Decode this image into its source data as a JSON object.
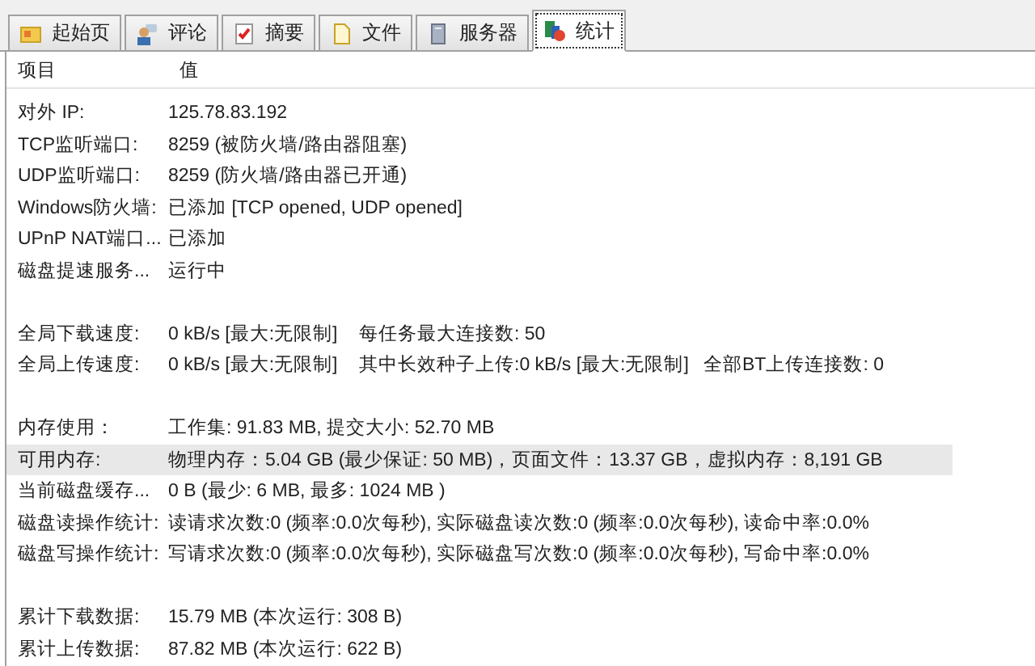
{
  "tabs": [
    {
      "label": "起始页",
      "selected": false
    },
    {
      "label": "评论",
      "selected": false
    },
    {
      "label": "摘要",
      "selected": false
    },
    {
      "label": "文件",
      "selected": false
    },
    {
      "label": "服务器",
      "selected": false
    },
    {
      "label": "统计",
      "selected": true
    }
  ],
  "table": {
    "columns": [
      "项目",
      "值"
    ],
    "groups": [
      [
        {
          "label": "对外 IP:",
          "values": [
            "125.78.83.192"
          ],
          "selected": false
        },
        {
          "label": "TCP监听端口:",
          "values": [
            "8259 (被防火墙/路由器阻塞)"
          ],
          "selected": false
        },
        {
          "label": "UDP监听端口:",
          "values": [
            "8259 (防火墙/路由器已开通)"
          ],
          "selected": false
        },
        {
          "label": "Windows防火墙:",
          "values": [
            "已添加 [TCP opened, UDP opened]"
          ],
          "selected": false
        },
        {
          "label": "UPnP NAT端口...",
          "values": [
            "已添加"
          ],
          "selected": false
        },
        {
          "label": "磁盘提速服务...",
          "values": [
            "运行中"
          ],
          "selected": false
        }
      ],
      [
        {
          "label": "全局下载速度:",
          "values": [
            "0 kB/s [最大:无限制]",
            "每任务最大连接数: 50"
          ],
          "selected": false
        },
        {
          "label": "全局上传速度:",
          "values": [
            "0 kB/s [最大:无限制]",
            "其中长效种子上传:0 kB/s [最大:无限制]",
            "全部BT上传连接数: 0"
          ],
          "selected": false
        }
      ],
      [
        {
          "label": "内存使用：",
          "values": [
            "工作集: 91.83 MB, 提交大小: 52.70 MB"
          ],
          "selected": false
        },
        {
          "label": "可用内存:",
          "values": [
            "物理内存：5.04 GB (最少保证: 50 MB)，页面文件：13.37 GB，虚拟内存：8,191 GB"
          ],
          "selected": true
        },
        {
          "label": "当前磁盘缓存...",
          "values": [
            "0 B (最少: 6 MB, 最多: 1024 MB )"
          ],
          "selected": false
        },
        {
          "label": "磁盘读操作统计:",
          "values": [
            "读请求次数:0 (频率:0.0次每秒), 实际磁盘读次数:0 (频率:0.0次每秒), 读命中率:0.0%"
          ],
          "selected": false
        },
        {
          "label": "磁盘写操作统计:",
          "values": [
            "写请求次数:0 (频率:0.0次每秒), 实际磁盘写次数:0 (频率:0.0次每秒), 写命中率:0.0%"
          ],
          "selected": false
        }
      ],
      [
        {
          "label": "累计下载数据:",
          "values": [
            "15.79 MB (本次运行: 308 B)"
          ],
          "selected": false
        },
        {
          "label": "累计上传数据:",
          "values": [
            "87.82 MB (本次运行: 622 B)"
          ],
          "selected": false
        }
      ]
    ]
  }
}
